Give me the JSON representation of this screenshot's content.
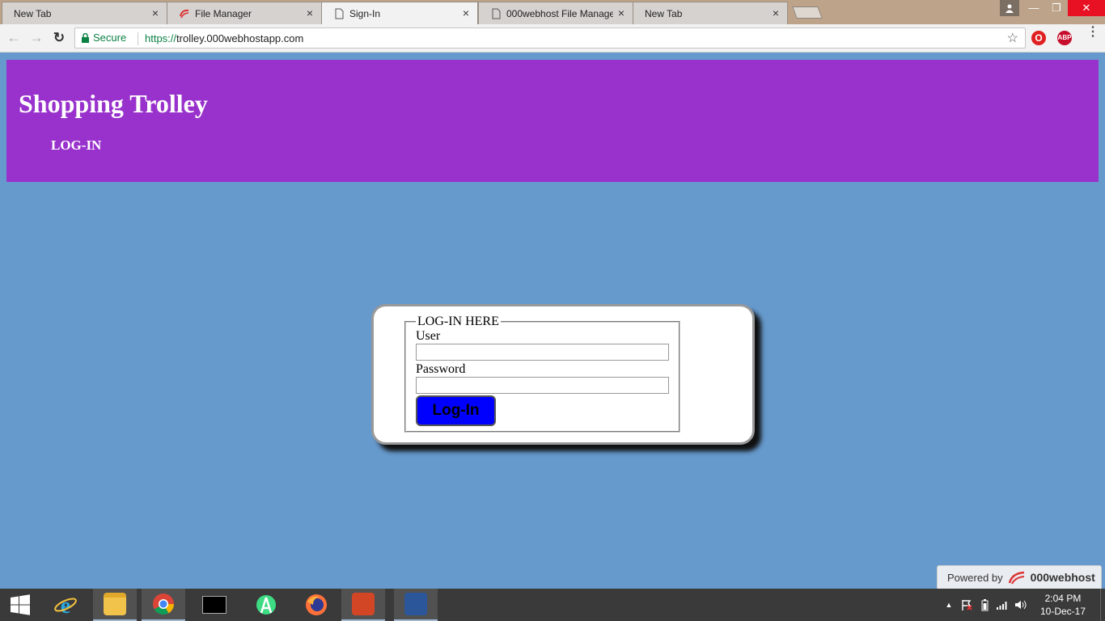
{
  "browser": {
    "tabs": [
      {
        "title": "New Tab",
        "active": false,
        "icon": "none"
      },
      {
        "title": "File Manager",
        "active": false,
        "icon": "000webhost-icon"
      },
      {
        "title": "Sign-In",
        "active": true,
        "icon": "page-icon"
      },
      {
        "title": "000webhost File Manage",
        "active": false,
        "icon": "page-icon"
      },
      {
        "title": "New Tab",
        "active": false,
        "icon": "none"
      }
    ],
    "tab_close_glyph": "×",
    "window_controls": {
      "minimize": "—",
      "restore": "❐",
      "close": "✕"
    },
    "toolbar": {
      "back": "←",
      "forward": "→",
      "reload": "↻",
      "secure_label": "Secure",
      "url_scheme": "https://",
      "url_host": "trolley.000webhostapp.com",
      "star": "☆",
      "opera_label": "O",
      "abp_label": "ABP",
      "menu": "⋮"
    }
  },
  "page": {
    "site_title": "Shopping Trolley",
    "nav_login": "LOG-IN",
    "form": {
      "legend": "LOG-IN HERE",
      "user_label": "User",
      "user_value": "",
      "password_label": "Password",
      "password_value": "",
      "submit_label": "Log-In"
    },
    "powered_by": "Powered by",
    "powered_brand": "000webhost"
  },
  "colors": {
    "page_bg": "#6699cc",
    "header_bg": "#9932cc",
    "button_bg": "#0000ff",
    "secure_green": "#0b8043"
  },
  "taskbar": {
    "apps": [
      "start-icon",
      "internet-explorer-icon",
      "file-explorer-icon",
      "chrome-icon",
      "command-prompt-icon",
      "android-studio-icon",
      "firefox-icon",
      "powerpoint-icon",
      "word-icon"
    ],
    "tray": {
      "chevron": "▲",
      "time": "2:04 PM",
      "date": "10-Dec-17"
    }
  }
}
